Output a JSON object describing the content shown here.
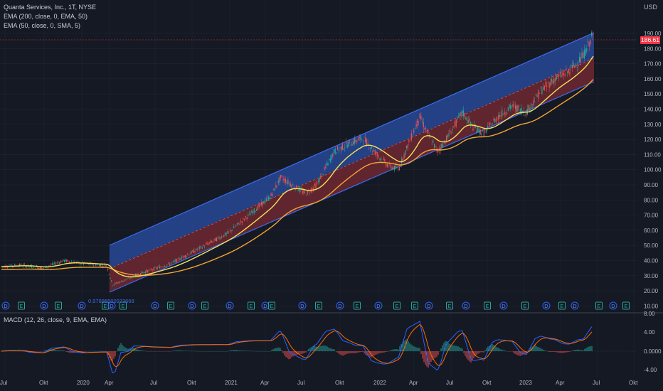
{
  "header": {
    "symbol_line": "Quanta Services, Inc., 1T, NYSE",
    "indicator_1": "EMA (200, close, 0, EMA, 50)",
    "indicator_2": "EMA (50, close, 0, SMA, 5)",
    "currency": "USD"
  },
  "price_axis": {
    "labels": [
      "190.00",
      "180.00",
      "170.00",
      "160.00",
      "150.00",
      "140.00",
      "130.00",
      "120.00",
      "110.00",
      "100.00",
      "90.00",
      "80.00",
      "70.00",
      "60.00",
      "50.00",
      "40.00",
      "30.00",
      "20.00",
      "10.00"
    ],
    "current_price": "186.61"
  },
  "macd_pane": {
    "title": "MACD (12, 26, close, 9, EMA, EMA)",
    "labels": [
      "8.00",
      "4.00",
      "0.0000",
      "-4.00"
    ]
  },
  "time_axis": {
    "labels": [
      "Jul",
      "Okt",
      "2020",
      "Apr",
      "Jul",
      "Okt",
      "2021",
      "Apr",
      "Jul",
      "Okt",
      "2022",
      "Apr",
      "Jul",
      "Okt",
      "2023",
      "Apr",
      "Jul",
      "Okt"
    ]
  },
  "channel_annotation": "0.97895500973668",
  "events": [
    {
      "type": "D"
    },
    {
      "type": "E"
    },
    {
      "type": "D"
    },
    {
      "type": "E"
    },
    {
      "type": "D"
    },
    {
      "type": "E"
    },
    {
      "type": "D"
    },
    {
      "type": "E"
    },
    {
      "type": "D"
    },
    {
      "type": "E"
    },
    {
      "type": "D"
    },
    {
      "type": "E"
    },
    {
      "type": "D"
    },
    {
      "type": "E"
    },
    {
      "type": "D"
    },
    {
      "type": "E"
    },
    {
      "type": "D"
    },
    {
      "type": "E"
    },
    {
      "type": "D"
    },
    {
      "type": "E"
    },
    {
      "type": "D"
    },
    {
      "type": "E"
    },
    {
      "type": "E"
    },
    {
      "type": "D"
    },
    {
      "type": "E"
    },
    {
      "type": "D"
    },
    {
      "type": "E"
    },
    {
      "type": "D"
    },
    {
      "type": "E"
    },
    {
      "type": "D"
    },
    {
      "type": "E"
    },
    {
      "type": "D"
    },
    {
      "type": "E"
    },
    {
      "type": "D"
    },
    {
      "type": "E"
    }
  ],
  "colors": {
    "background": "#151924",
    "grid": "#242833",
    "up_candle": "#26a69a",
    "down_candle": "#ef5350",
    "ema_fast": "#f5e15a",
    "ema_slow": "#f4a531",
    "channel_upper_fill": "#2b4fa6",
    "channel_lower_fill": "#7a2a33",
    "channel_line": "#3b6cf0",
    "macd_line": "#2962ff",
    "signal_line": "#ff6d00",
    "current_price": "#f23645"
  }
}
